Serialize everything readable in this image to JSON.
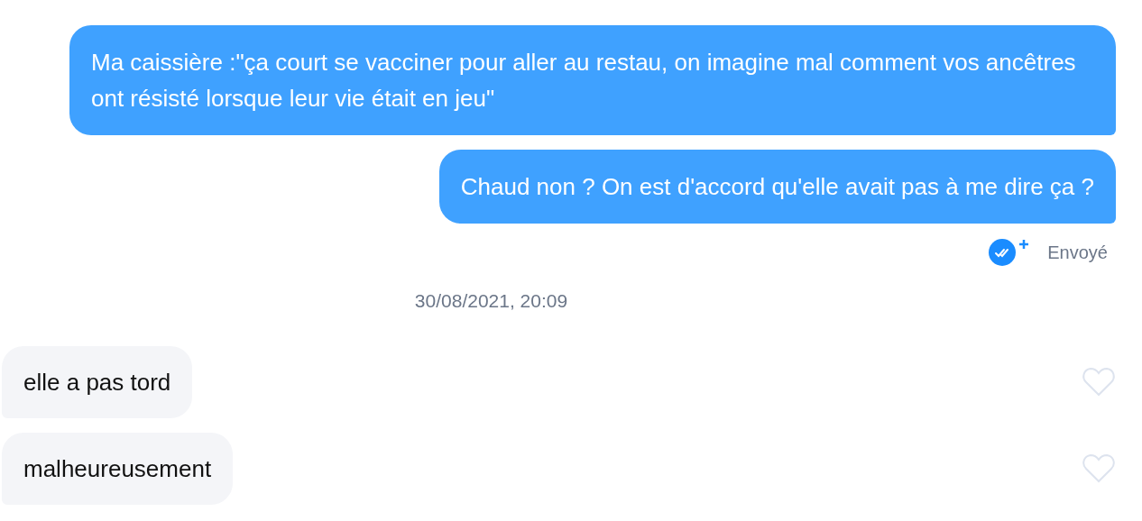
{
  "messages": [
    {
      "kind": "sent",
      "text": "Ma caissière :\"ça court se vacciner pour aller au restau, on imagine mal comment vos ancêtres ont résisté lorsque leur vie était en jeu\""
    },
    {
      "kind": "sent",
      "text": "Chaud non ? On est d'accord qu'elle avait pas à me dire ça ?"
    },
    {
      "kind": "status",
      "text": "Envoyé"
    },
    {
      "kind": "timestamp",
      "text": "30/08/2021, 20:09"
    },
    {
      "kind": "received",
      "text": "elle a pas tord",
      "liked": false
    },
    {
      "kind": "received",
      "text": "malheureusement",
      "liked": false
    }
  ]
}
